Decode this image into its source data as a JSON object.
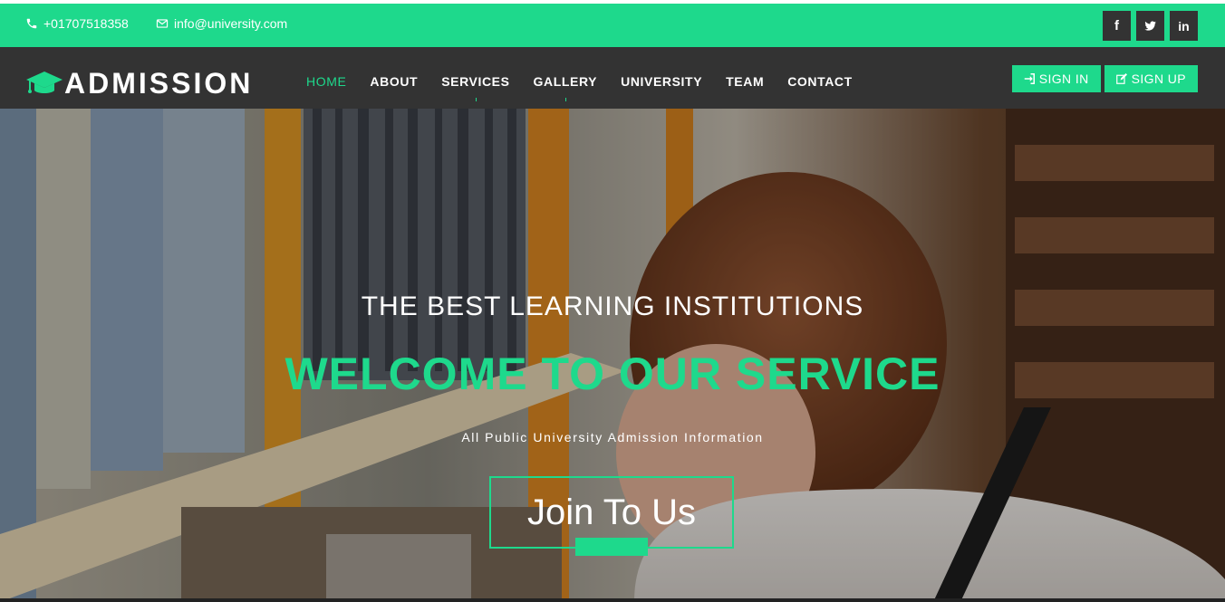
{
  "topbar": {
    "phone": "+01707518358",
    "email": "info@university.com",
    "socials": [
      {
        "icon": "facebook-icon",
        "glyph": "f"
      },
      {
        "icon": "twitter-icon",
        "glyph": ""
      },
      {
        "icon": "linkedin-icon",
        "glyph": "in"
      }
    ]
  },
  "navbar": {
    "brand": "ADMISSION",
    "brand_icon": "graduation-cap-icon",
    "items": [
      {
        "label": "HOME",
        "active": true
      },
      {
        "label": "ABOUT"
      },
      {
        "label": "SERVICES"
      },
      {
        "label": "GALLERY"
      },
      {
        "label": "UNIVERSITY"
      },
      {
        "label": "TEAM"
      },
      {
        "label": "CONTACT"
      }
    ],
    "signin": "SIGN IN",
    "signup": "SIGN UP"
  },
  "hero": {
    "kicker": "THE BEST LEARNING INSTITUTIONS",
    "headline": "WELCOME TO OUR SERVICE",
    "sub": "All Public University Admission Information",
    "cta": "Join To Us"
  },
  "colors": {
    "accent": "#1ed98c",
    "dark": "#333333",
    "text_light": "#ffffff"
  }
}
